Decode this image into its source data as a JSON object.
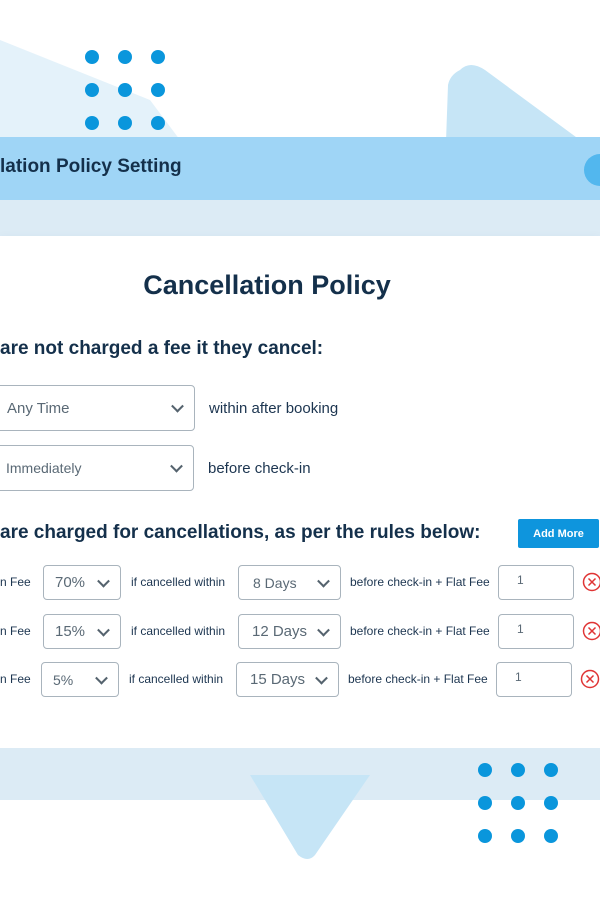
{
  "header": {
    "title": "lation Policy Setting"
  },
  "card": {
    "title": "Cancellation Policy"
  },
  "free_section": {
    "heading": "are not charged a fee it they cancel:",
    "rows": [
      {
        "select_value": "Any Time",
        "suffix": "within after booking"
      },
      {
        "select_value": "Immediately",
        "suffix": "before check-in"
      }
    ]
  },
  "charged_section": {
    "heading": "are charged for cancellations, as per the rules below:",
    "add_more_label": "Add More",
    "rows": [
      {
        "fee_label": "n Fee",
        "percent": "70%",
        "within_label": "if cancelled within",
        "days": "8 Days",
        "flat_label": "before check-in + Flat Fee",
        "flat_value": "1"
      },
      {
        "fee_label": "n Fee",
        "percent": "15%",
        "within_label": "if cancelled within",
        "days": "12 Days",
        "flat_label": "before check-in + Flat Fee",
        "flat_value": "1"
      },
      {
        "fee_label": "n Fee",
        "percent": "5%",
        "within_label": "if cancelled within",
        "days": "15 Days",
        "flat_label": "before check-in + Flat Fee",
        "flat_value": "1"
      }
    ]
  },
  "colors": {
    "accent": "#0e95dd",
    "header_band": "#9fd5f6",
    "delete": "#e03535",
    "title": "#14304b"
  },
  "icons": [
    "chevron-down-icon",
    "delete-icon"
  ]
}
